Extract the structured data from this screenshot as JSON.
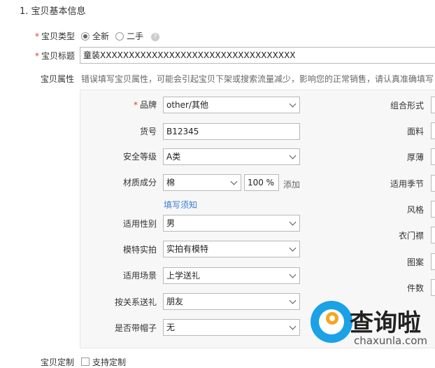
{
  "section_title": "1. 宝贝基本信息",
  "type_row": {
    "label": "宝贝类型",
    "options": [
      "全新",
      "二手"
    ],
    "selected": "全新",
    "help": "?"
  },
  "title_row": {
    "label": "宝贝标题",
    "value": "童装XXXXXXXXXXXXXXXXXXXXXXXXXXXXXXXXXX"
  },
  "attr_row": {
    "label": "宝贝属性",
    "hint": "错误填写宝贝属性，可能会引起宝贝下架或搜索流量减少，影响您的正常销售，请认真准确填写！"
  },
  "left_fields": {
    "brand": {
      "label": "品牌",
      "value": "other/其他"
    },
    "item_no": {
      "label": "货号",
      "value": "B12345"
    },
    "safety": {
      "label": "安全等级",
      "value": "A类"
    },
    "material": {
      "label": "材质成分",
      "value": "棉",
      "percent": "100",
      "percent_unit": "%",
      "add_label": "添加",
      "notice": "填写须知"
    },
    "gender": {
      "label": "适用性别",
      "value": "男"
    },
    "model": {
      "label": "模特实拍",
      "value": "实拍有模特"
    },
    "scene": {
      "label": "适用场景",
      "value": "上学送礼"
    },
    "relation": {
      "label": "按关系送礼",
      "value": "朋友"
    },
    "hat": {
      "label": "是否带帽子",
      "value": "无"
    }
  },
  "right_labels": [
    "组合形式",
    "面料",
    "厚薄",
    "适用季节",
    "风格",
    "衣门襟",
    "图案",
    "件数"
  ],
  "bottom_row": {
    "label": "宝贝定制",
    "option": "支持定制"
  },
  "watermark": {
    "brand": "查询啦",
    "domain": "chaxunla.com"
  }
}
